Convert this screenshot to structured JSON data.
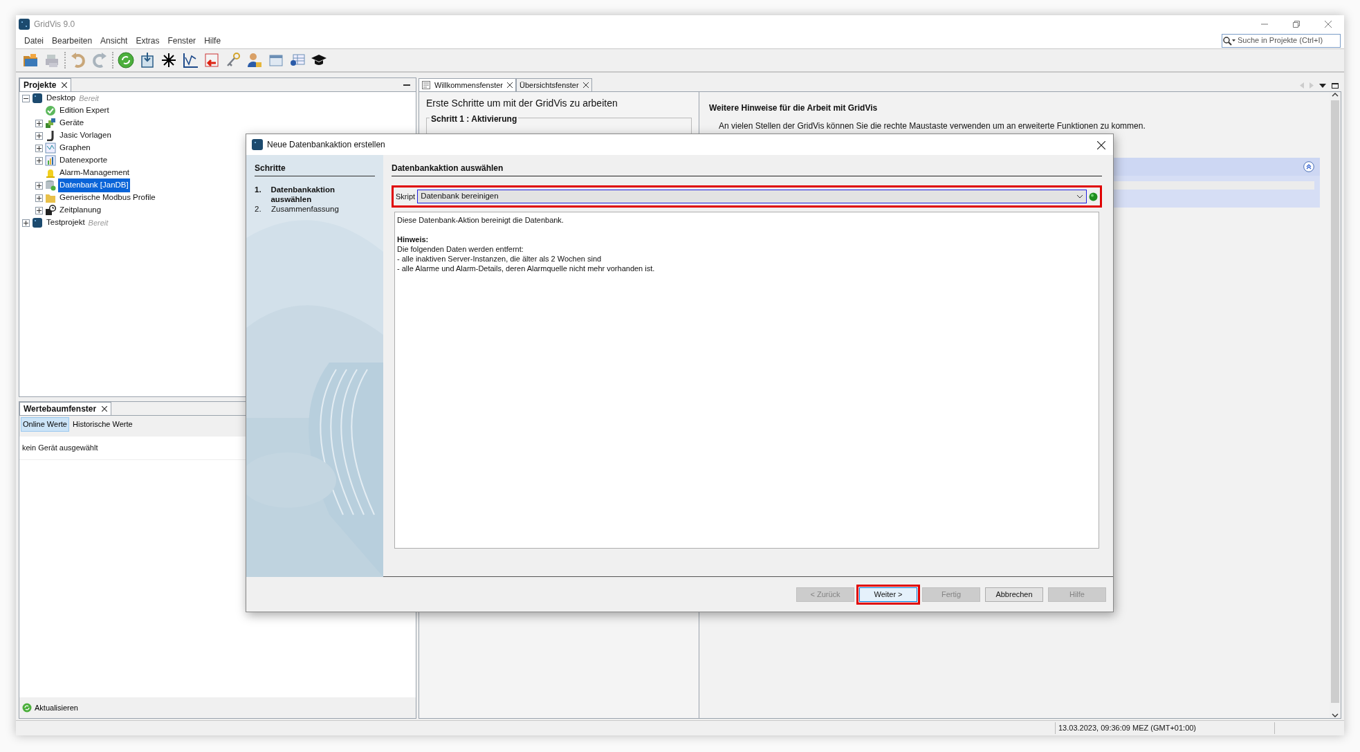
{
  "window": {
    "title": "GridVis 9.0"
  },
  "menu": [
    "Datei",
    "Bearbeiten",
    "Ansicht",
    "Extras",
    "Fenster",
    "Hilfe"
  ],
  "search": {
    "placeholder": "Suche in Projekte (Ctrl+I)"
  },
  "projects_panel": {
    "title": "Projekte",
    "tree": [
      {
        "label": "Desktop",
        "status": "Bereit",
        "kind": "project",
        "expanded": true,
        "selected": false,
        "children": [
          {
            "label": "Edition Expert",
            "kind": "license",
            "selected": false
          },
          {
            "label": "Geräte",
            "kind": "devices",
            "expanded": false,
            "selected": false
          },
          {
            "label": "Jasic Vorlagen",
            "kind": "script",
            "expanded": false,
            "selected": false
          },
          {
            "label": "Graphen",
            "kind": "graph",
            "expanded": false,
            "selected": false
          },
          {
            "label": "Datenexporte",
            "kind": "export",
            "expanded": false,
            "selected": false
          },
          {
            "label": "Alarm-Management",
            "kind": "alarm",
            "selected": false
          },
          {
            "label": "Datenbank [JanDB]",
            "kind": "database",
            "expanded": false,
            "selected": true
          },
          {
            "label": "Generische Modbus Profile",
            "kind": "profile",
            "expanded": false,
            "selected": false
          },
          {
            "label": "Zeitplanung",
            "kind": "schedule",
            "expanded": false,
            "selected": false
          }
        ]
      },
      {
        "label": "Testprojekt",
        "status": "Bereit",
        "kind": "project",
        "expanded": false,
        "selected": false
      }
    ]
  },
  "values_panel": {
    "title": "Wertebaumfenster",
    "tabs": [
      {
        "label": "Online Werte",
        "selected": true
      },
      {
        "label": "Historische Werte",
        "selected": false
      }
    ],
    "message": "kein Gerät ausgewählt",
    "refresh_button": "Aktualisieren"
  },
  "editor_tabs": [
    {
      "label": "Willkommensfenster",
      "selected": true
    },
    {
      "label": "Übersichtsfenster",
      "selected": false
    }
  ],
  "welcome": {
    "heading": "Erste Schritte um mit der GridVis zu arbeiten",
    "step_title": "Schritt 1 : Aktivierung",
    "hints_title": "Weitere Hinweise für die Arbeit mit GridVis",
    "hint": "An vielen Stellen der GridVis können Sie die rechte Maustaste verwenden um an erweiterte Funktionen zu kommen."
  },
  "dialog": {
    "title": "Neue Datenbankaktion erstellen",
    "steps_title": "Schritte",
    "steps": [
      {
        "number": "1.",
        "label": "Datenbankaktion auswählen",
        "selected": true
      },
      {
        "number": "2.",
        "label": "Zusammenfassung",
        "selected": false
      }
    ],
    "section_title": "Datenbankaktion auswählen",
    "script": {
      "label": "Skript",
      "value": "Datenbank bereinigen",
      "highlighted": true
    },
    "description": [
      {
        "kind": "text",
        "text": "Diese Datenbank-Aktion bereinigt die Datenbank."
      },
      {
        "kind": "heading",
        "text": "Hinweis:"
      },
      {
        "kind": "text",
        "text": "Die folgenden Daten werden entfernt:"
      },
      {
        "kind": "text",
        "text": "- alle inaktiven Server-Instanzen, die älter als 2 Wochen sind"
      },
      {
        "kind": "text",
        "text": "- alle Alarme und Alarm-Details, deren Alarmquelle nicht mehr vorhanden ist."
      }
    ],
    "buttons": [
      {
        "label": "< Zurück",
        "disabled": true,
        "highlighted": false
      },
      {
        "label": "Weiter >",
        "disabled": false,
        "highlighted": true
      },
      {
        "label": "Fertig",
        "disabled": true,
        "highlighted": false
      },
      {
        "label": "Abbrechen",
        "disabled": false,
        "highlighted": false
      },
      {
        "label": "Hilfe",
        "disabled": true,
        "highlighted": false
      }
    ]
  },
  "status_bar": {
    "timestamp": "13.03.2023, 09:36:09 MEZ (GMT+01:00)"
  }
}
